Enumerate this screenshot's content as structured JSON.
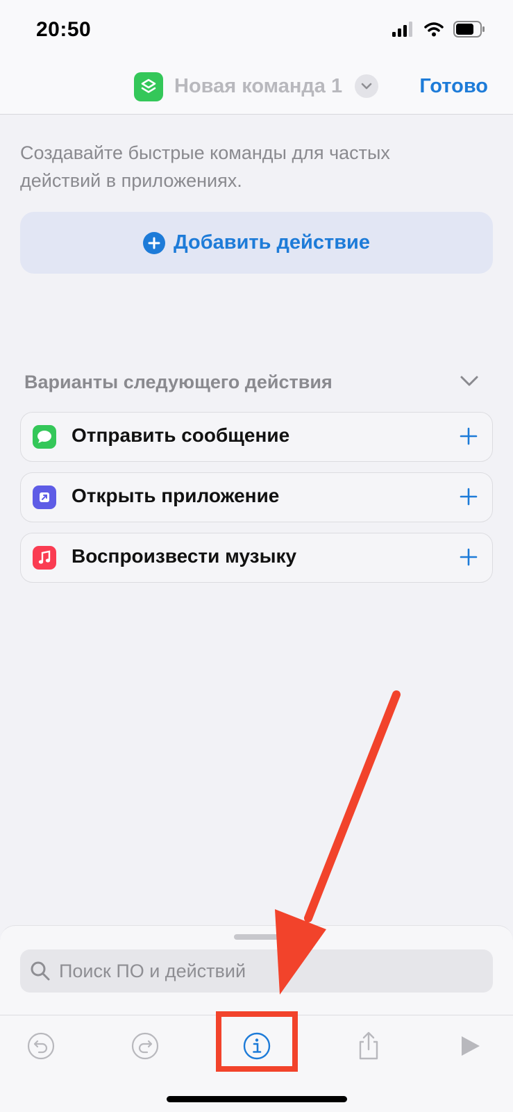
{
  "status_bar": {
    "time": "20:50"
  },
  "nav": {
    "title": "Новая команда 1",
    "done": "Готово",
    "app_icon": "shortcuts-layers-icon"
  },
  "intro": "Создавайте быстрые команды для частых действий в приложениях.",
  "add_action": {
    "label": "Добавить действие"
  },
  "suggestions": {
    "header": "Варианты следующего действия",
    "items": [
      {
        "label": "Отправить сообщение",
        "icon": "messages-icon",
        "color": "#34c759"
      },
      {
        "label": "Открыть приложение",
        "icon": "open-app-icon",
        "color": "#5e5ce6"
      },
      {
        "label": "Воспроизвести музыку",
        "icon": "music-icon",
        "color": "#fa3c52"
      }
    ]
  },
  "search": {
    "placeholder": "Поиск ПО и действий"
  },
  "toolbar": {
    "items": [
      "undo-icon",
      "redo-icon",
      "info-icon",
      "share-icon",
      "play-icon"
    ],
    "highlighted": "info-icon"
  },
  "colors": {
    "accent": "#1d7bd8",
    "annotation": "#f2432b"
  }
}
